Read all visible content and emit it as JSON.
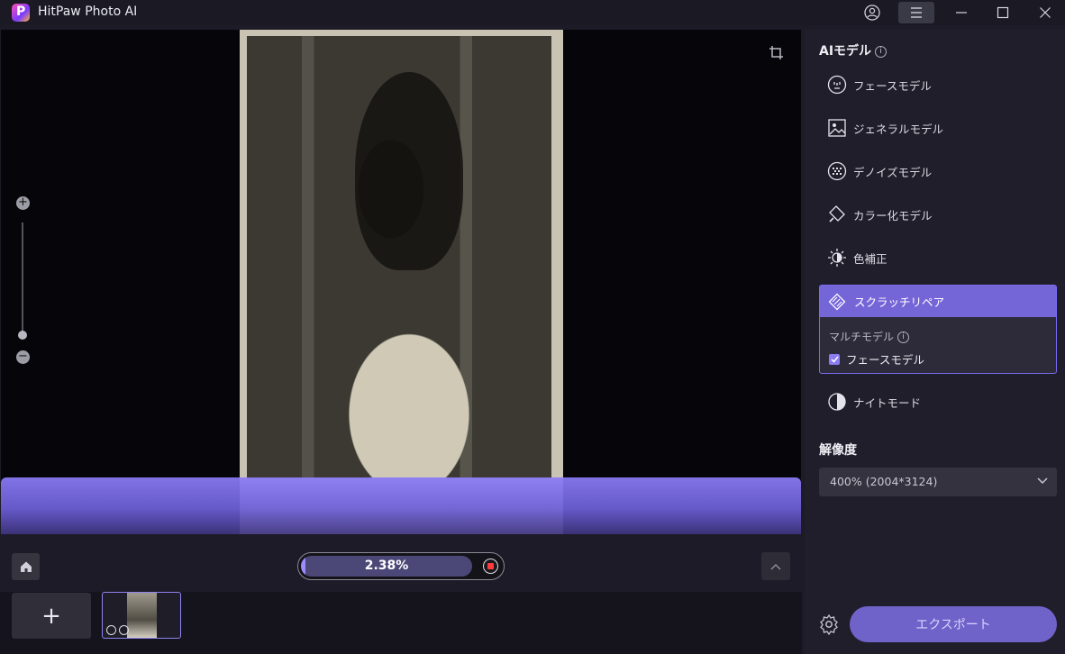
{
  "app": {
    "title": "HitPaw Photo AI",
    "logo_letter": "P"
  },
  "panel": {
    "ai_model_title": "AIモデル",
    "models": [
      {
        "label": "フェースモデル",
        "icon": "face-icon"
      },
      {
        "label": "ジェネラルモデル",
        "icon": "image-icon"
      },
      {
        "label": "デノイズモデル",
        "icon": "denoise-icon"
      },
      {
        "label": "カラー化モデル",
        "icon": "color-bucket-icon"
      },
      {
        "label": "色補正",
        "icon": "brightness-icon"
      },
      {
        "label": "スクラッチリペア",
        "icon": "scratch-icon",
        "selected": true
      },
      {
        "label": "ナイトモード",
        "icon": "night-icon"
      }
    ],
    "multi_model_label": "マルチモデル",
    "multi_model_option": "フェースモデル",
    "multi_model_checked": true,
    "resolution_title": "解像度",
    "resolution_value": "400% (2004*3124)",
    "export_label": "エクスポート"
  },
  "progress": {
    "text": "2.38%",
    "value": 0.0238
  },
  "colors": {
    "accent": "#7566d8",
    "export": "#6f63c9"
  }
}
